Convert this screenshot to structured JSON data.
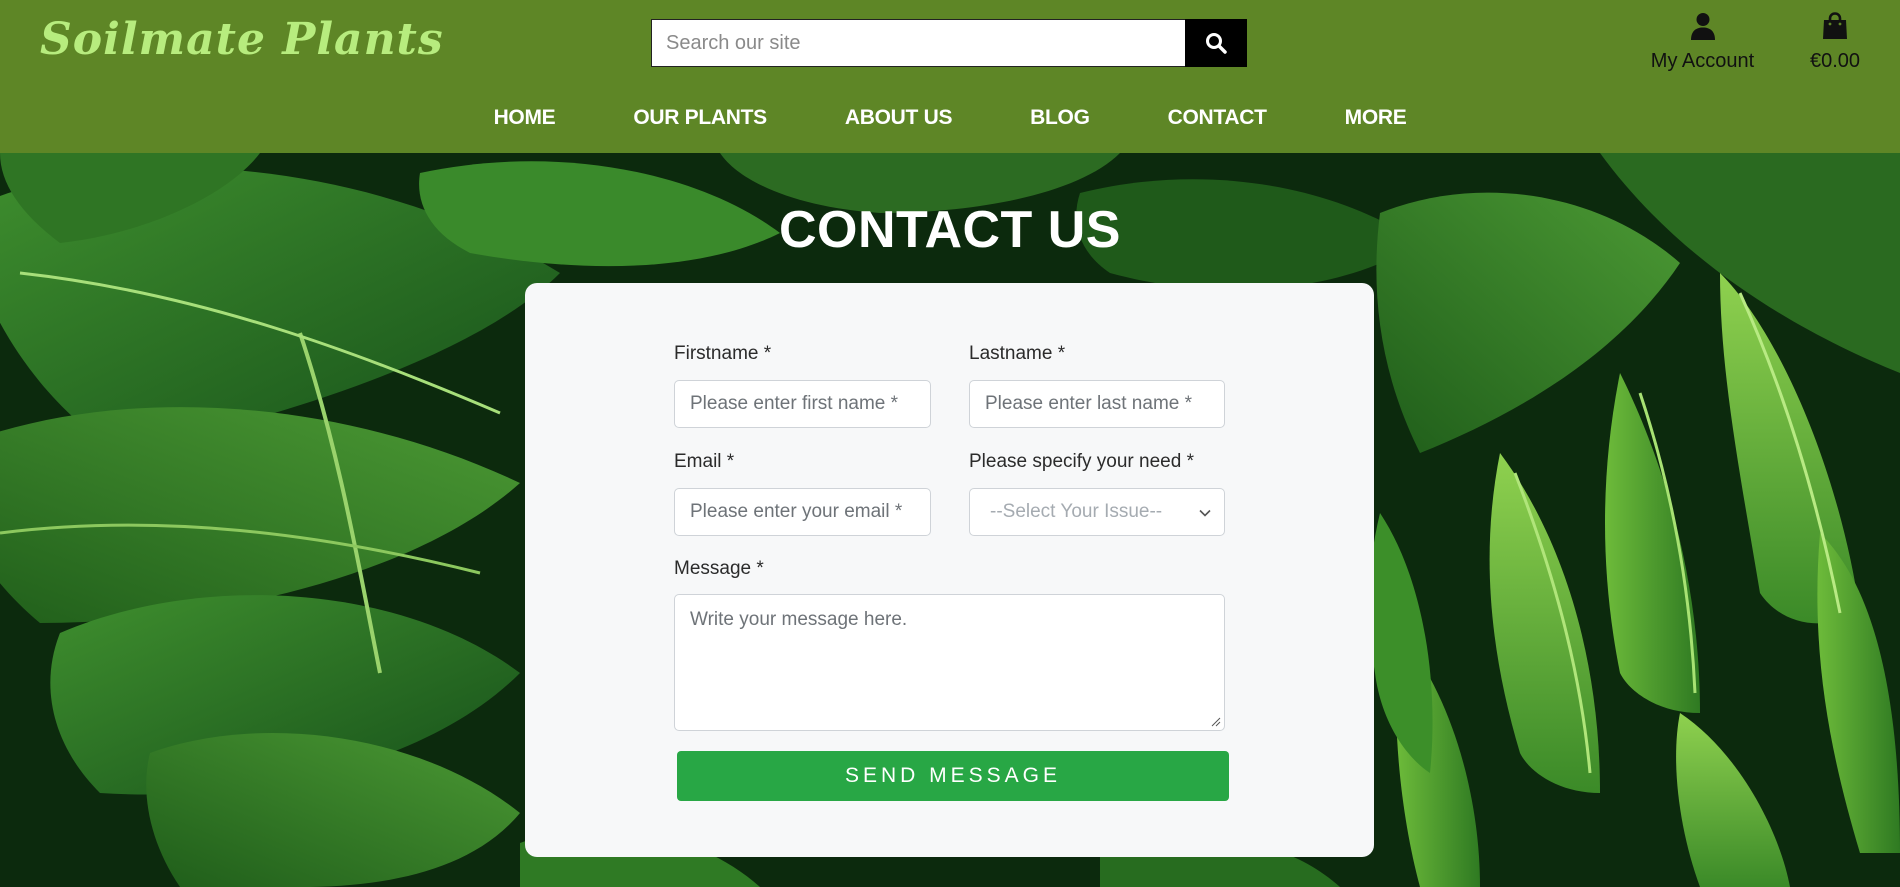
{
  "brand": {
    "name": "Soilmate Plants",
    "logo_color": "#b7ec7e",
    "header_color": "#5e8626"
  },
  "search": {
    "placeholder": "Search our site",
    "icon": "search-icon"
  },
  "account": {
    "label": "My Account",
    "icon": "user-icon"
  },
  "cart": {
    "total": "€0.00",
    "icon": "shopping-bag-icon"
  },
  "nav": {
    "items": [
      {
        "label": "HOME"
      },
      {
        "label": "OUR PLANTS"
      },
      {
        "label": "ABOUT US"
      },
      {
        "label": "BLOG"
      },
      {
        "label": "CONTACT"
      },
      {
        "label": "MORE"
      }
    ]
  },
  "page": {
    "title": "CONTACT US"
  },
  "form": {
    "firstname": {
      "label": "Firstname *",
      "placeholder": "Please enter first name *"
    },
    "lastname": {
      "label": "Lastname *",
      "placeholder": "Please enter last name *"
    },
    "email": {
      "label": "Email *",
      "placeholder": "Please enter your email *"
    },
    "need": {
      "label": "Please specify your need *",
      "selected": "--Select Your Issue--"
    },
    "message": {
      "label": "Message *",
      "placeholder": "Write your message here."
    },
    "submit_label": "SEND MESSAGE",
    "submit_color": "#28a745"
  }
}
